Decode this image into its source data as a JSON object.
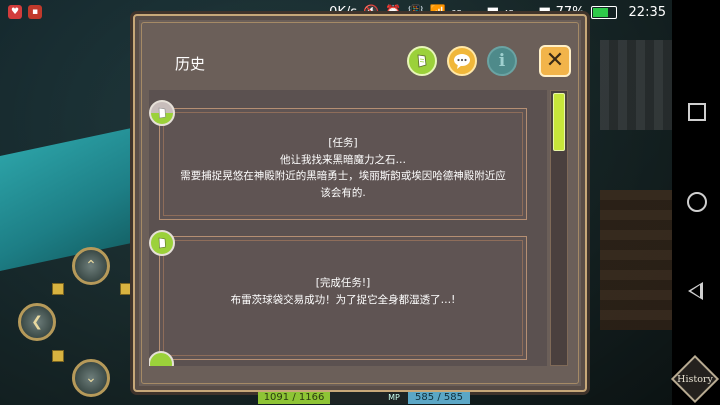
{
  "status_bar": {
    "net_speed": "0K/s",
    "battery_percent": "77%",
    "battery_level": 0.77,
    "time": "22:35",
    "signal_a": "2G",
    "signal_b": "4G"
  },
  "dialog": {
    "title": "历史",
    "header_buttons": [
      {
        "name": "quest-filter",
        "icon": "quest-page-icon",
        "color": "#9bd13a"
      },
      {
        "name": "chat-filter",
        "icon": "chat-bubble-icon",
        "color": "#f0b73a"
      },
      {
        "name": "info-filter",
        "icon": "info-icon",
        "glyph": "i",
        "color": "#4e8a8a"
      }
    ],
    "close_glyph": "✕",
    "entries": [
      {
        "tag": "[任务]",
        "lines": [
          "他让我找来黑暗魔力之石…",
          "需要捕捉晃悠在神殿附近的黑暗勇士，埃丽斯韵或埃因哈德神殿附近应",
          "该会有的."
        ]
      },
      {
        "tag": "[完成任务!]",
        "lines": [
          "布雷茨球袋交易成功！为了捉它全身都湿透了…!"
        ]
      }
    ],
    "scroll_position": 0.0
  },
  "hud": {
    "hp_text": "1091 / 1166",
    "mp_label": "MP",
    "mp_text": "585 / 585"
  },
  "history_button": {
    "label": "History"
  },
  "colors": {
    "accent_green": "#9bd13a",
    "accent_orange": "#f0b73a",
    "dialog_bg": "#6b5f59",
    "frame": "#c7a879"
  }
}
